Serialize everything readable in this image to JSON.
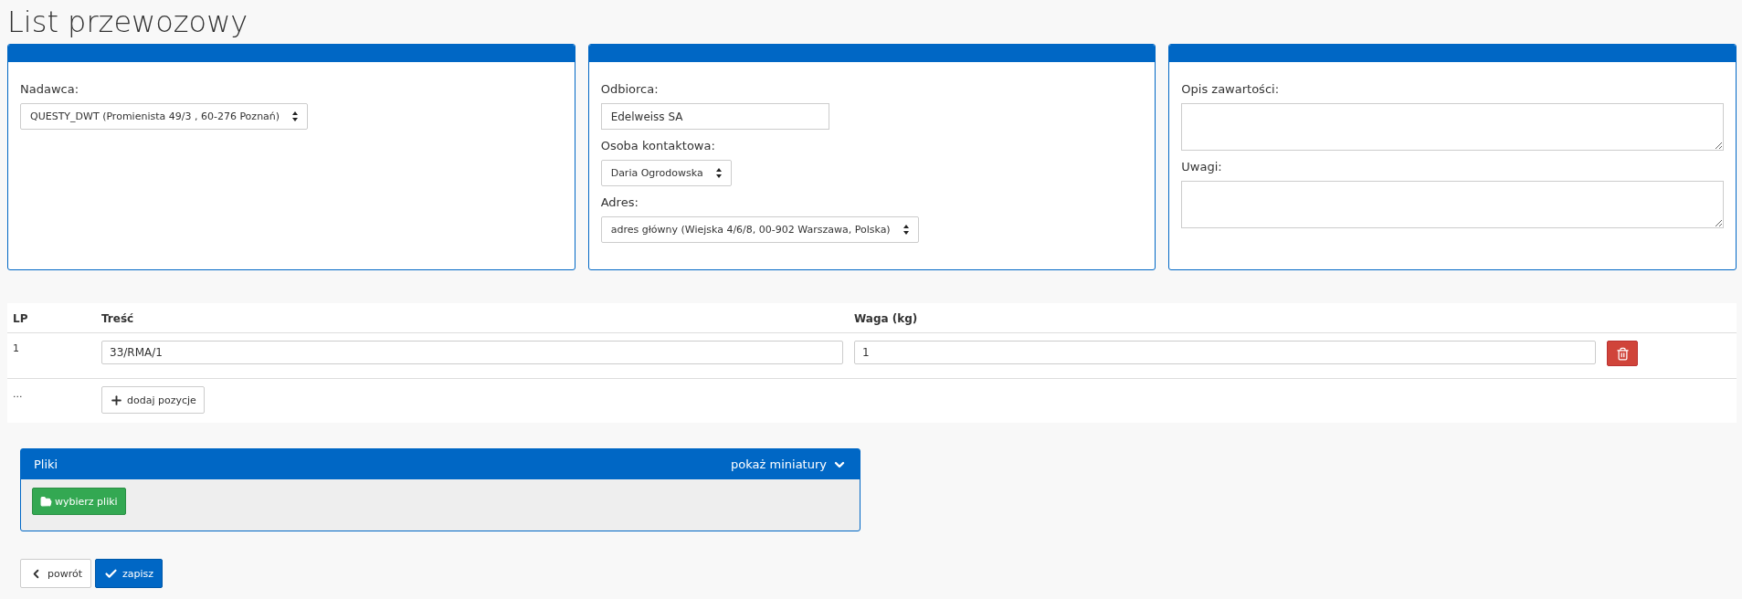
{
  "title": "List przewozowy",
  "panels": [
    {
      "fields": [
        {
          "kind": "select",
          "label": "Nadawca:",
          "value": "QUESTY_DWT (Promienista 49/3 , 60-276 Poznań)"
        }
      ]
    },
    {
      "fields": [
        {
          "kind": "input",
          "label": "Odbiorca:",
          "value": "Edelweiss SA"
        },
        {
          "kind": "select",
          "label": "Osoba kontaktowa:",
          "value": "Daria Ogrodowska"
        },
        {
          "kind": "select",
          "label": "Adres:",
          "value": "adres główny (Wiejska 4/6/8, 00-902 Warszawa, Polska)"
        }
      ]
    },
    {
      "fields": [
        {
          "kind": "textarea",
          "label": "Opis zawartości:"
        },
        {
          "kind": "textarea",
          "label": "Uwagi:"
        }
      ]
    }
  ],
  "items": {
    "columns": [
      "LP",
      "Treść",
      "Waga (kg)"
    ],
    "rows": [
      {
        "lp": "1",
        "content": "33/RMA/1",
        "weight": "1"
      }
    ],
    "add_row": {
      "lp": "...",
      "button": "dodaj pozycje"
    }
  },
  "files": {
    "title": "Pliki",
    "toggle": "pokaż miniatury",
    "button": "wybierz pliki"
  },
  "actions": [
    {
      "kind": "back",
      "label": "powrót"
    },
    {
      "kind": "save",
      "label": "zapisz"
    }
  ]
}
